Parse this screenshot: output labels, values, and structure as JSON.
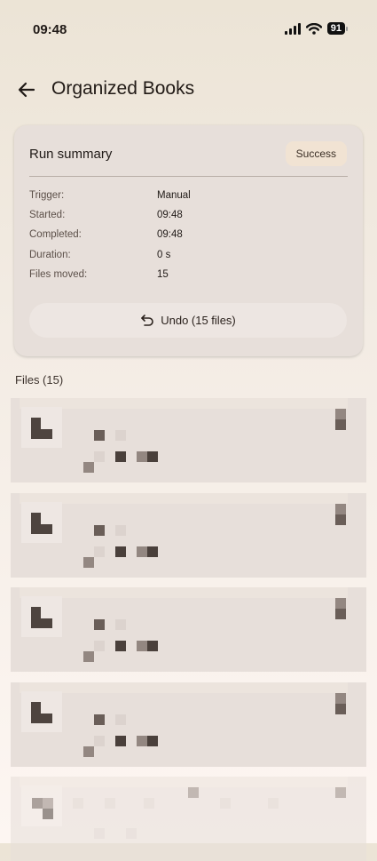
{
  "status_bar": {
    "time": "09:48",
    "battery": "91"
  },
  "header": {
    "title": "Organized Books"
  },
  "summary": {
    "title": "Run summary",
    "status": "Success",
    "rows": [
      {
        "label": "Trigger:",
        "value": "Manual"
      },
      {
        "label": "Started:",
        "value": "09:48"
      },
      {
        "label": "Completed:",
        "value": "09:48"
      },
      {
        "label": "Duration:",
        "value": "0 s"
      },
      {
        "label": "Files moved:",
        "value": "15"
      }
    ],
    "undo_label": "Undo (15 files)"
  },
  "files": {
    "heading": "Files (15)"
  },
  "icons": {
    "back": "arrow-left-icon",
    "undo": "undo-icon",
    "signal": "signal-icon",
    "wifi": "wifi-icon",
    "battery": "battery-icon",
    "file": "file-icon"
  }
}
